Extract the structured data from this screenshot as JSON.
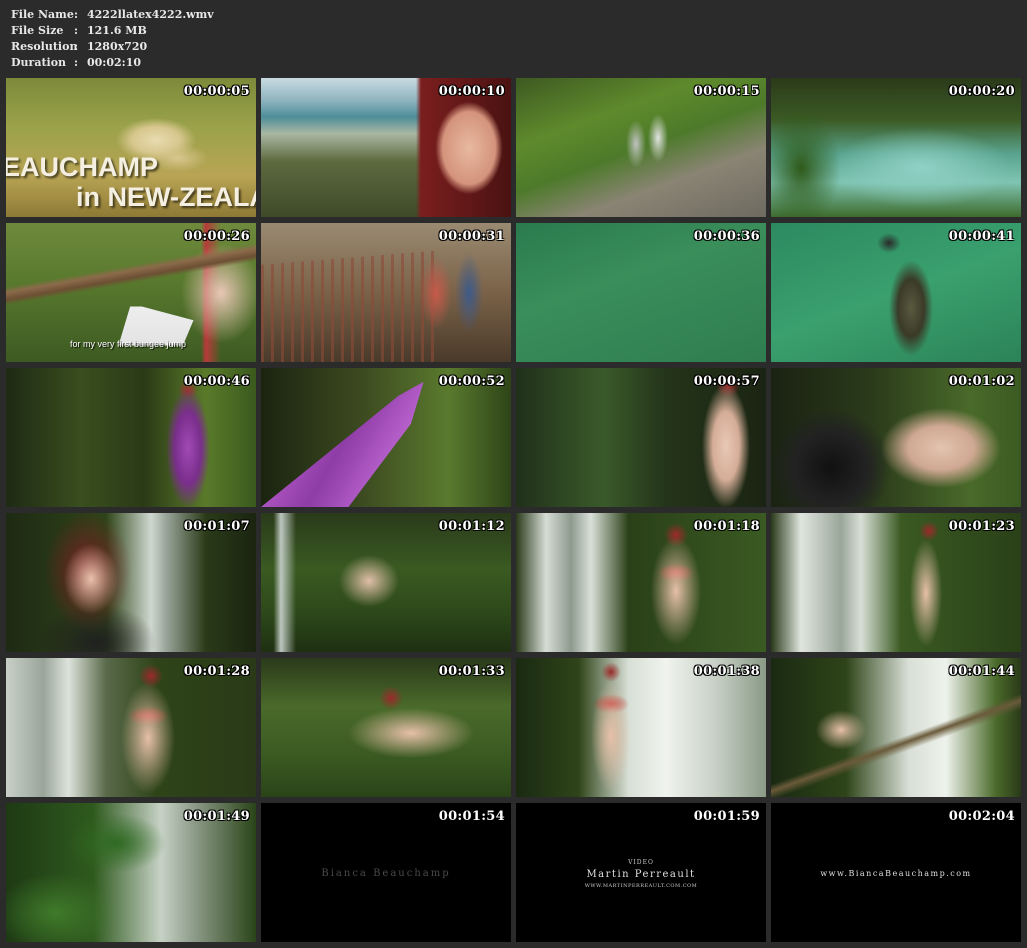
{
  "file_info": {
    "rows": [
      {
        "label": "File Name",
        "value": "4222llatex4222.wmv"
      },
      {
        "label": "File Size",
        "value": "121.6 MB"
      },
      {
        "label": "Resolution",
        "value": "1280x720"
      },
      {
        "label": "Duration",
        "value": "00:02:10"
      }
    ],
    "separator": ":"
  },
  "thumbnails": [
    {
      "time": "00:00:05",
      "scene": "grass-rocks-title",
      "title_line1": "EAUCHAMP",
      "title_line2": "in NEW-ZEALA"
    },
    {
      "time": "00:00:10",
      "scene": "beach-face"
    },
    {
      "time": "00:00:15",
      "scene": "cliff-birds"
    },
    {
      "time": "00:00:20",
      "scene": "river-gorge"
    },
    {
      "time": "00:00:26",
      "scene": "bridge-woman",
      "caption": "for my very first bungee jump"
    },
    {
      "time": "00:00:31",
      "scene": "bridge-closeup"
    },
    {
      "time": "00:00:36",
      "scene": "green-water"
    },
    {
      "time": "00:00:41",
      "scene": "bungee-jump"
    },
    {
      "time": "00:00:46",
      "scene": "forest-purple"
    },
    {
      "time": "00:00:52",
      "scene": "forest-purple-2"
    },
    {
      "time": "00:00:57",
      "scene": "forest-skin"
    },
    {
      "time": "00:01:02",
      "scene": "forest-skin-2"
    },
    {
      "time": "00:01:07",
      "scene": "waterfall-portrait"
    },
    {
      "time": "00:01:12",
      "scene": "forest-floor"
    },
    {
      "time": "00:01:18",
      "scene": "waterfall-red"
    },
    {
      "time": "00:01:23",
      "scene": "waterfall-red-2"
    },
    {
      "time": "00:01:28",
      "scene": "waterfall-red-3"
    },
    {
      "time": "00:01:33",
      "scene": "forest-red-lying"
    },
    {
      "time": "00:01:38",
      "scene": "waterfall-red-4"
    },
    {
      "time": "00:01:44",
      "scene": "waterfall-red-5"
    },
    {
      "time": "00:01:49",
      "scene": "waterfall-ferns"
    },
    {
      "time": "00:01:54",
      "scene": "black-credit",
      "credit_text": "Bianca Beauchamp"
    },
    {
      "time": "00:01:59",
      "scene": "black-credit-video",
      "credit_small": "VIDEO",
      "credit_text": "Martin Perreault",
      "credit_url": "WWW.MARTINPERREAULT.COM.COM"
    },
    {
      "time": "00:02:04",
      "scene": "black-credit-url",
      "credit_text": "www.BiancaBeauchamp.com"
    }
  ]
}
